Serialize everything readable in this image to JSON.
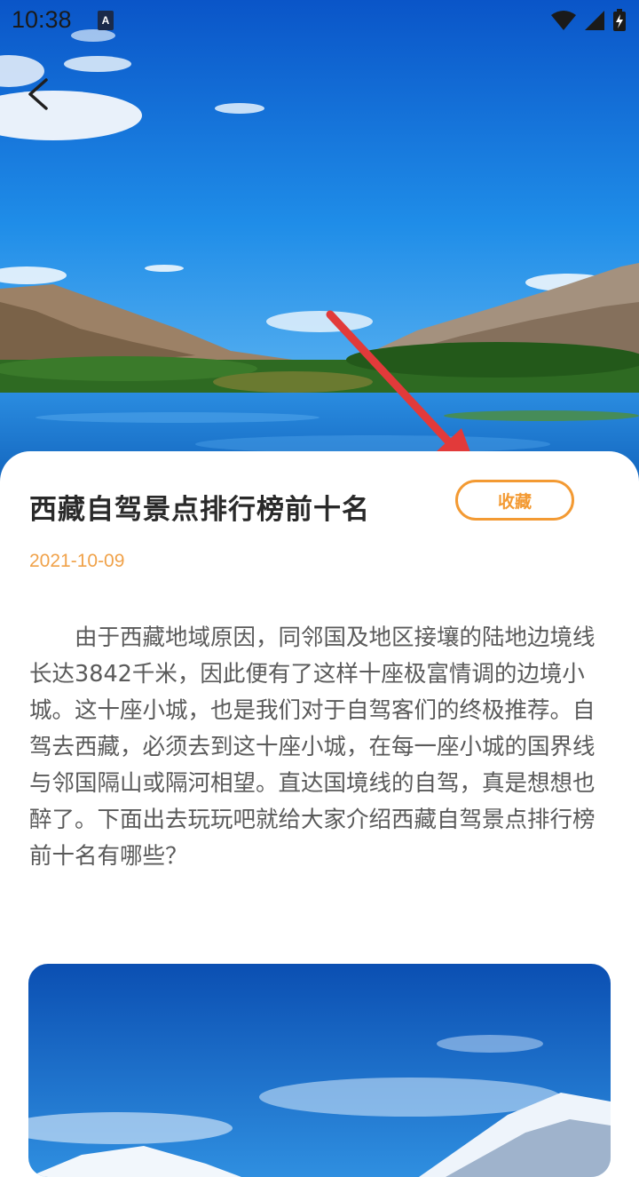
{
  "status_bar": {
    "time": "10:38",
    "notification_icon": "a-icon",
    "wifi_icon": "wifi-icon",
    "signal_icon": "signal-icon",
    "battery_icon": "battery-charging-icon"
  },
  "header": {
    "back_icon": "chevron-left-icon"
  },
  "article": {
    "title": "西藏自驾景点排行榜前十名",
    "favorite_label": "收藏",
    "date": "2021-10-09",
    "body": "由于西藏地域原因，同邻国及地区接壤的陆地边境线长达3842千米，因此便有了这样十座极富情调的边境小城。这十座小城，也是我们对于自驾客们的终极推荐。自驾去西藏，必须去到这十座小城，在每一座小城的国界线与邻国隔山或隔河相望。直达国境线的自驾，真是想想也醉了。下面出去玩玩吧就给大家介绍西藏自驾景点排行榜前十名有哪些？"
  },
  "colors": {
    "accent": "#f39a33",
    "date": "#f0a24a",
    "annotation_arrow": "#e23a3a"
  }
}
